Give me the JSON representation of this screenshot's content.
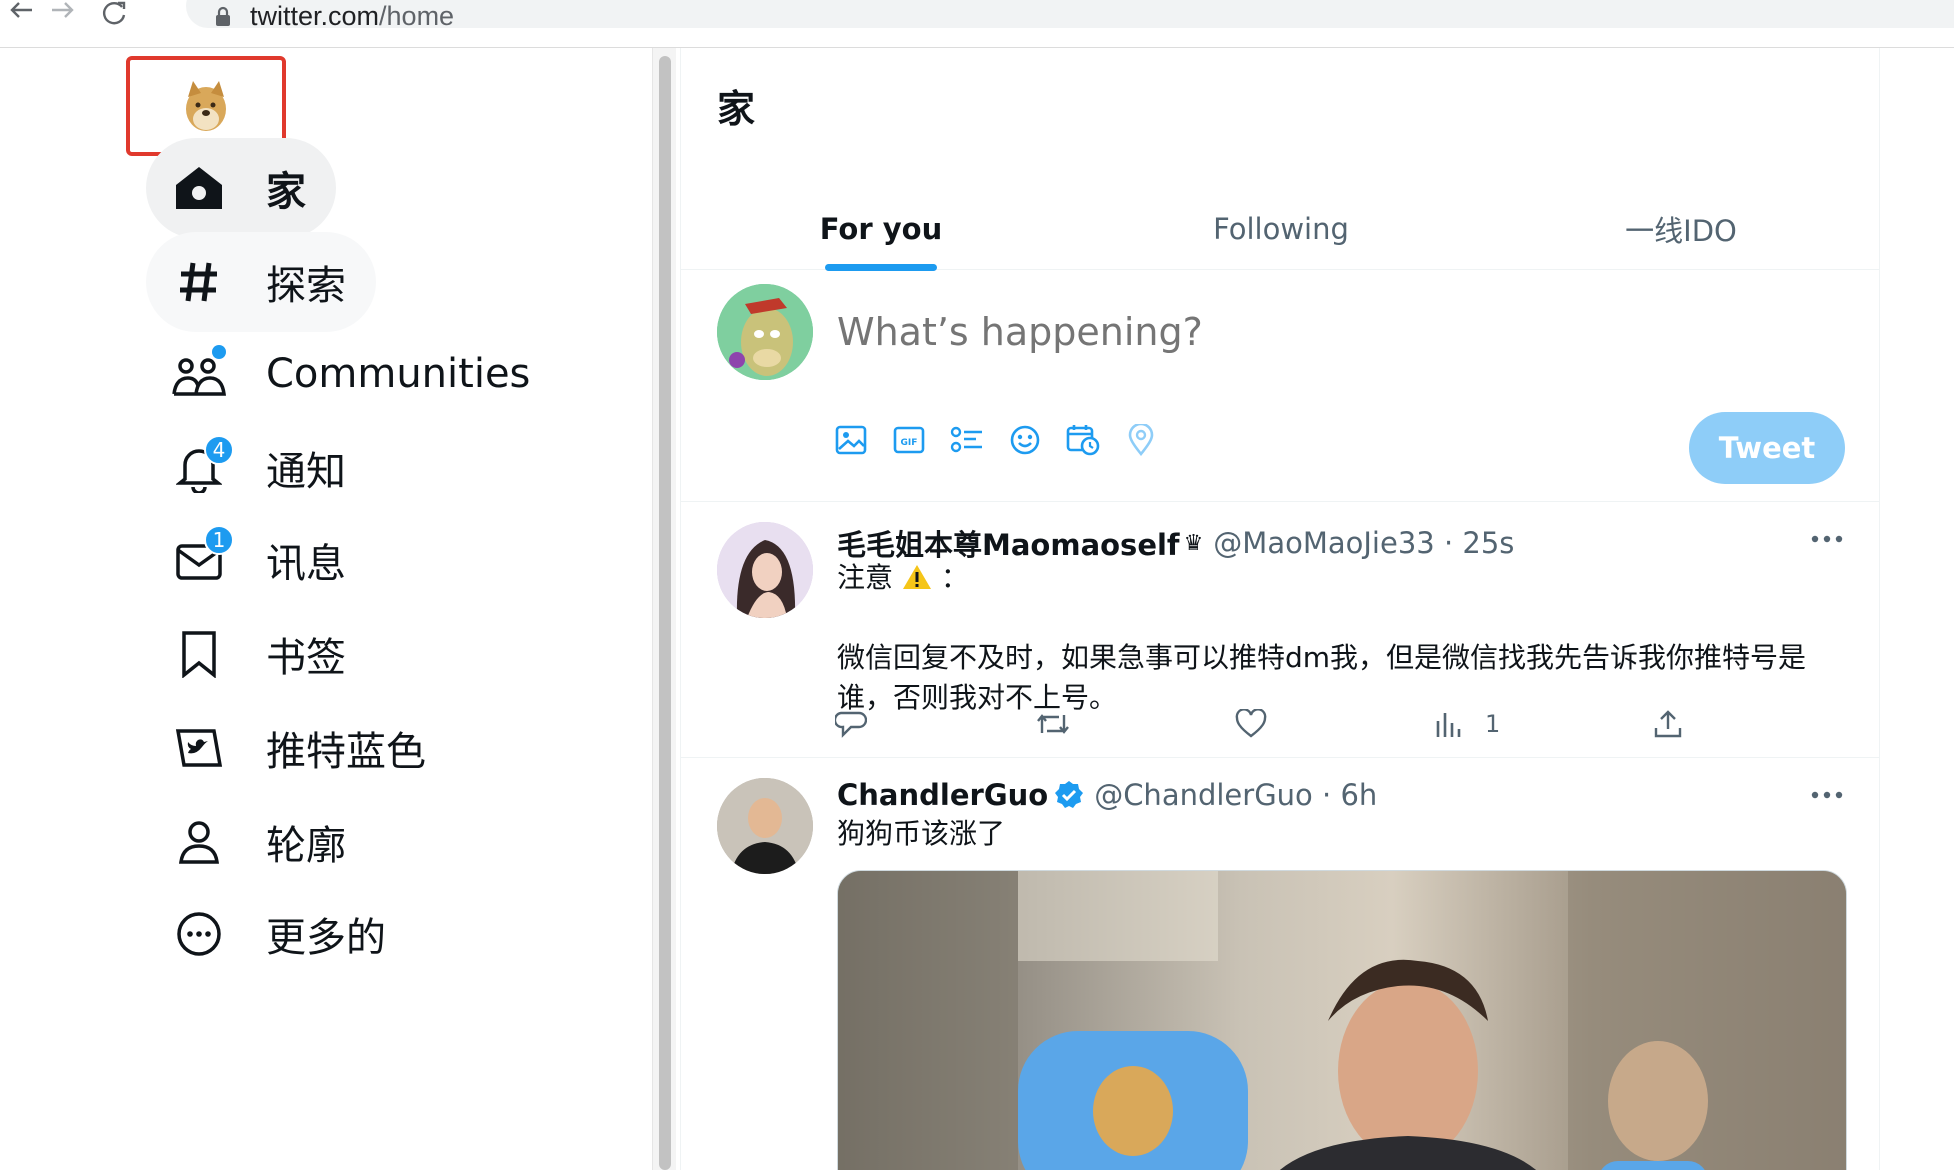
{
  "browser": {
    "url_host": "twitter.com",
    "url_path": "/home"
  },
  "sidebar": {
    "logo_icon": "doge-logo-icon",
    "items": [
      {
        "label": "家",
        "icon": "home-icon",
        "active": true
      },
      {
        "label": "探索",
        "icon": "hashtag-icon"
      },
      {
        "label": "Communities",
        "icon": "communities-icon",
        "dot": true
      },
      {
        "label": "通知",
        "icon": "bell-icon",
        "badge": "4"
      },
      {
        "label": "讯息",
        "icon": "mail-icon",
        "badge": "1"
      },
      {
        "label": "书签",
        "icon": "bookmark-icon"
      },
      {
        "label": "推特蓝色",
        "icon": "twitter-blue-icon"
      },
      {
        "label": "轮廓",
        "icon": "profile-icon"
      },
      {
        "label": "更多的",
        "icon": "more-circle-icon"
      }
    ]
  },
  "main": {
    "title": "家",
    "tabs": [
      {
        "label": "For you",
        "active": true
      },
      {
        "label": "Following"
      },
      {
        "label": "一线IDO"
      }
    ],
    "composer": {
      "placeholder": "What’s happening?",
      "tools": [
        "image-icon",
        "gif-icon",
        "poll-icon",
        "emoji-icon",
        "schedule-icon",
        "location-icon"
      ],
      "tweet_button": "Tweet"
    },
    "tweets": [
      {
        "name": "毛毛姐本尊Maomaoself",
        "name_suffix": "♛",
        "handle": "@MaoMaoJie33 · 25s",
        "text_line1": "注意",
        "text_line1_suffix": "：",
        "text_body": "微信回复不及时，如果急事可以推特dm我，但是微信找我先告诉我你推特号是谁，否则我对不上号。",
        "views": "1"
      },
      {
        "name": "ChandlerGuo",
        "verified": true,
        "handle": "@ChandlerGuo · 6h",
        "text": "狗狗币该涨了"
      }
    ]
  },
  "colors": {
    "accent": "#1d9bf0",
    "tweet_button_disabled": "#8ecdf8",
    "highlight_box": "#e0392d"
  }
}
